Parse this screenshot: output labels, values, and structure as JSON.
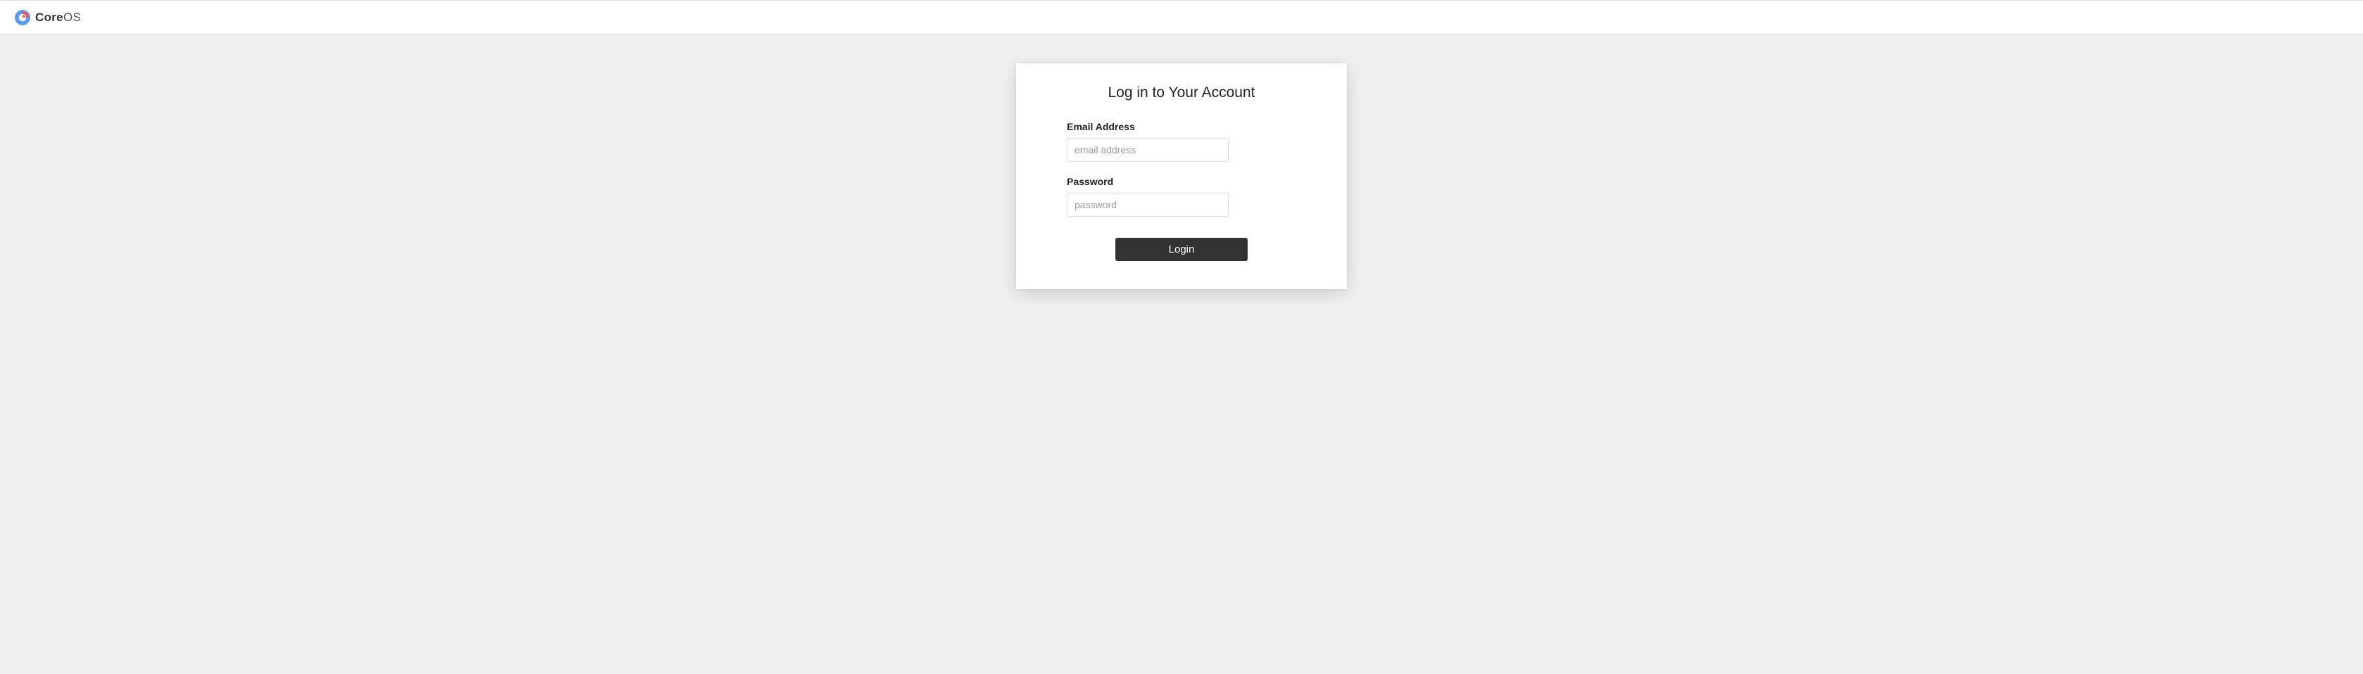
{
  "header": {
    "brand_bold": "Core",
    "brand_light": "OS"
  },
  "login": {
    "title": "Log in to Your Account",
    "email": {
      "label": "Email Address",
      "placeholder": "email address",
      "value": ""
    },
    "password": {
      "label": "Password",
      "placeholder": "password",
      "value": ""
    },
    "button_label": "Login"
  }
}
